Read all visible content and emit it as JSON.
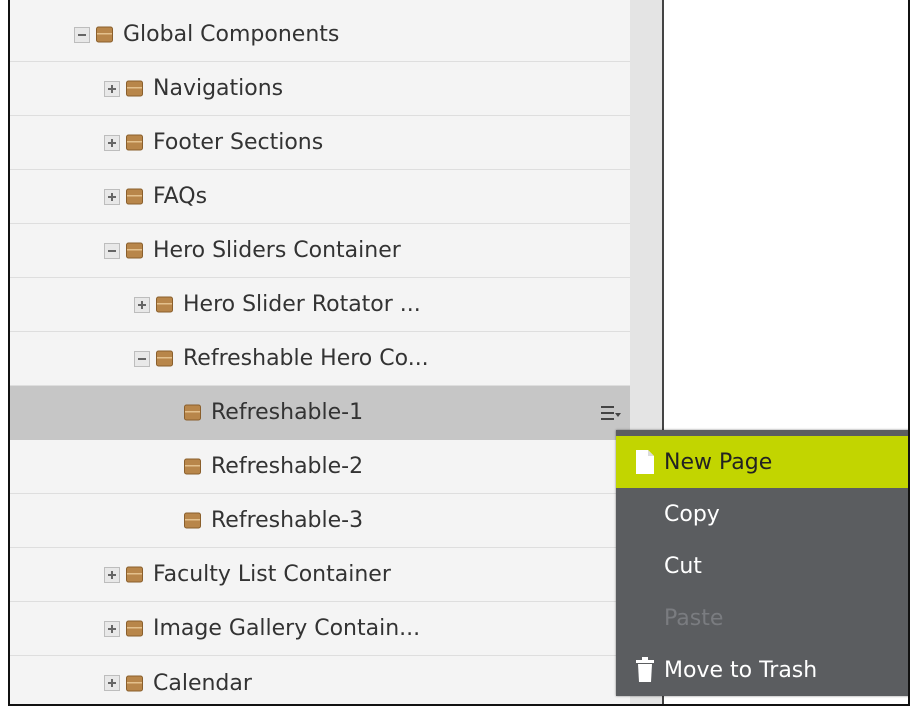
{
  "tree": {
    "items": [
      {
        "label": "Global Components",
        "toggle": "minus"
      },
      {
        "label": "Navigations",
        "toggle": "plus"
      },
      {
        "label": "Footer Sections",
        "toggle": "plus"
      },
      {
        "label": "FAQs",
        "toggle": "plus"
      },
      {
        "label": "Hero Sliders Container",
        "toggle": "minus"
      },
      {
        "label": "Hero Slider Rotator ...",
        "toggle": "plus"
      },
      {
        "label": "Refreshable Hero Co...",
        "toggle": "minus"
      },
      {
        "label": "Refreshable-1",
        "toggle": "none",
        "selected": true
      },
      {
        "label": "Refreshable-2",
        "toggle": "none"
      },
      {
        "label": "Refreshable-3",
        "toggle": "none"
      },
      {
        "label": "Faculty List Container",
        "toggle": "plus"
      },
      {
        "label": "Image Gallery Contain...",
        "toggle": "plus"
      },
      {
        "label": "Calendar",
        "toggle": "plus"
      }
    ]
  },
  "context_menu": {
    "items": [
      {
        "label": "New Page",
        "icon": "new-page-icon",
        "state": "highlighted"
      },
      {
        "label": "Copy",
        "icon": "",
        "state": "normal"
      },
      {
        "label": "Cut",
        "icon": "",
        "state": "normal"
      },
      {
        "label": "Paste",
        "icon": "",
        "state": "disabled"
      },
      {
        "label": "Move to Trash",
        "icon": "trash-icon",
        "state": "normal"
      }
    ]
  },
  "colors": {
    "menu_background": "#5b5d60",
    "menu_highlight": "#c2d500",
    "selected_row": "#c6c6c6",
    "folder": "#b8864a"
  }
}
